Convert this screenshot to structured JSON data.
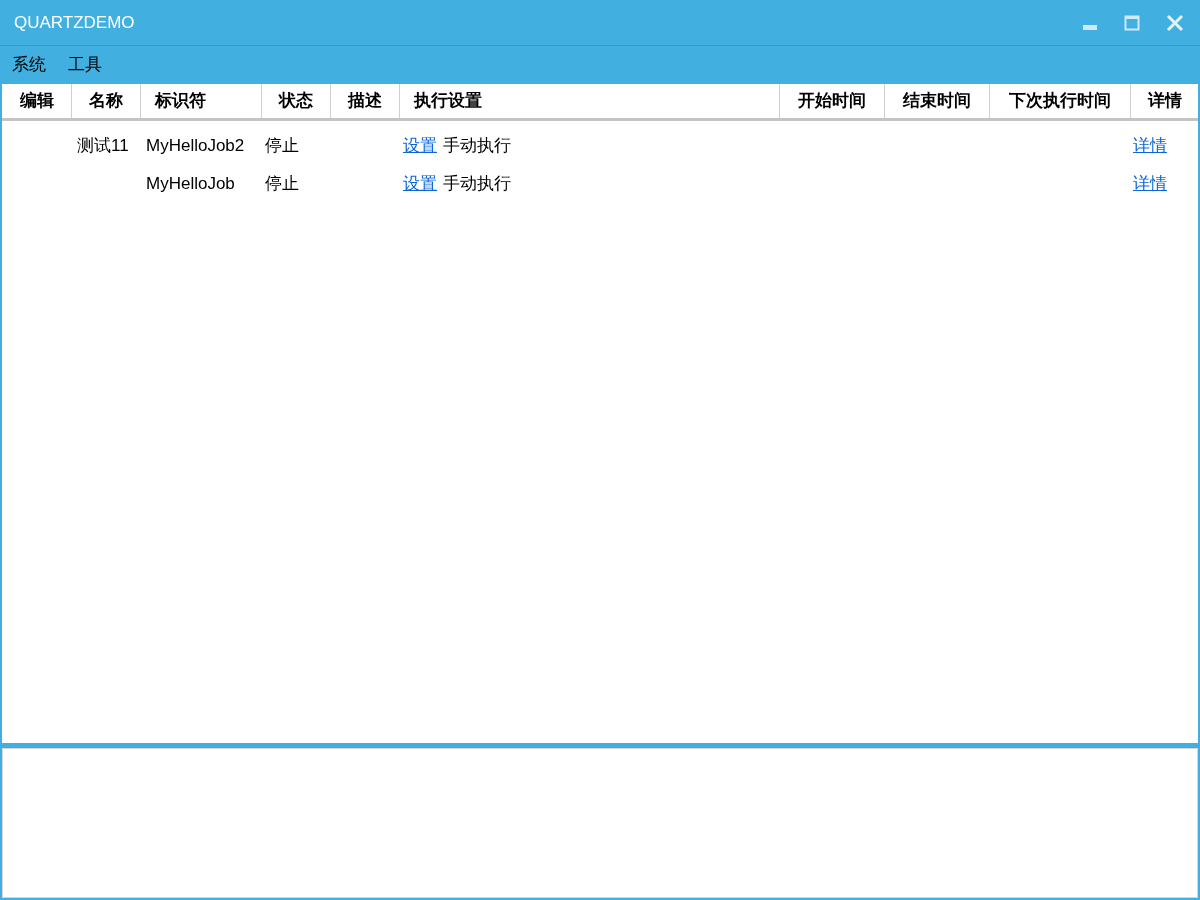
{
  "window": {
    "title": "QUARTZDEMO"
  },
  "menu": [
    "系统",
    "工具"
  ],
  "table": {
    "columns": [
      "编辑",
      "名称",
      "标识符",
      "状态",
      "描述",
      "执行设置",
      "开始时间",
      "结束时间",
      "下次执行时间",
      "详情"
    ],
    "rows": [
      {
        "name": "测试11",
        "identifier": "MyHelloJob2",
        "status": "停止",
        "setting_link": "设置",
        "setting_text": "手动执行",
        "details_link": "详情"
      },
      {
        "identifier": "MyHelloJob",
        "status": "停止",
        "setting_link": "设置",
        "setting_text": "手动执行",
        "details_link": "详情"
      }
    ]
  }
}
